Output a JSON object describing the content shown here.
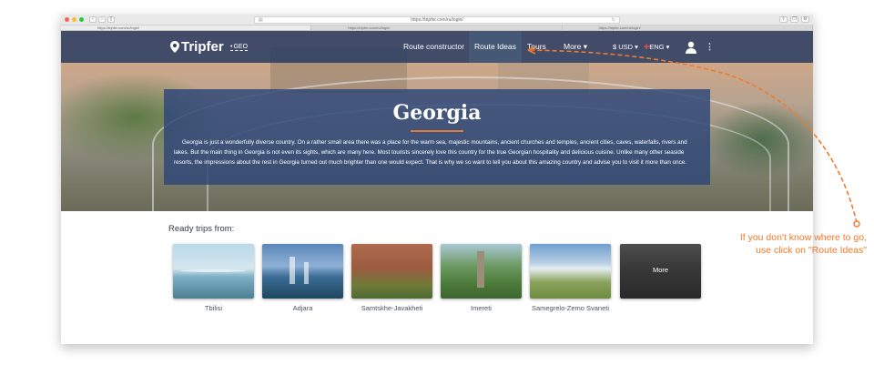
{
  "browser": {
    "url": "https://tripfer.com/ru/login/",
    "tabs": [
      "https://tripfer.com/ru/login/",
      "https://tripfer.com/ru/login/",
      "https://tripfer.com/ru/login/"
    ]
  },
  "header": {
    "logo": "Tripfer",
    "geo_label": "GEO",
    "nav": [
      "Route constructor",
      "Route Ideas",
      "Tours",
      "More ▾"
    ],
    "currency": "$ USD ▾",
    "language": "ENG ▾",
    "menu_glyph": "⋮"
  },
  "hero": {
    "title": "Georgia",
    "description": "Georgia is just a wonderfully diverse country. On a rather small area there was a place for the warm sea, majestic mountains, ancient churches and temples, ancient cities, caves, waterfalls, rivers and lakes. But the main thing in Georgia is not even its sights, which are many here. Most tourists sincerely love this country for the true Georgian hospitality and delicious cuisine. Unlike many other seaside resorts, the impressions about the rest in Georgia turned out much brighter than one would expect. That is why we so want to tell you about this amazing country and advise you to visit it more than once."
  },
  "ready_trips": {
    "title": "Ready trips from:",
    "items": [
      "Tbilisi",
      "Adjara",
      "Samtskhe-Javakheti",
      "Imereti",
      "Samegrelo-Zemo Svaneti"
    ],
    "more_label": "More"
  },
  "annotation": {
    "line1": "If you don't know where to go,",
    "line2": "use click on \"Route Ideas\""
  },
  "colors": {
    "nav_bg": "#2c3e63",
    "panel_bg": "#2d4678",
    "accent": "#f07a2a"
  }
}
